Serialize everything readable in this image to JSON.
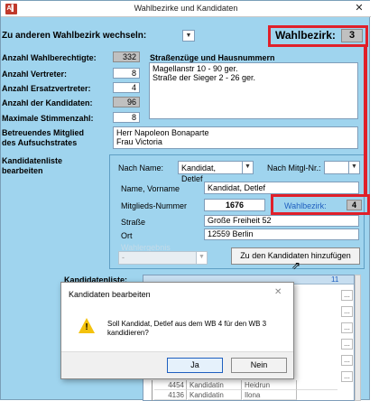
{
  "window": {
    "title": "Wahlbezirke und Kandidaten",
    "app_icon": "A▌",
    "close": "✕"
  },
  "header": {
    "switch_label": "Zu anderen Wahlbezirk wechseln:",
    "wb_label": "Wahlbezirk:",
    "wb_value": "3"
  },
  "stats": {
    "wahlberechtigte_label": "Anzahl Wahlberechtigte:",
    "wahlberechtigte": "332",
    "vertreter_label": "Anzahl Vertreter:",
    "vertreter": "8",
    "ersatz_label": "Anzahl Ersatzvertreter:",
    "ersatz": "4",
    "kandidaten_label": "Anzahl der Kandidaten:",
    "kandidaten": "96",
    "stimmen_label": "Maximale Stimmenzahl:",
    "stimmen": "8"
  },
  "streets": {
    "label": "Straßenzüge und Hausnummern",
    "line1": "Magellanstr 10 - 90  ger.",
    "line2": "Straße der Sieger 2 - 26 ger."
  },
  "mitglied": {
    "label_line1": "Betreuendes Mitglied",
    "label_line2": "des Aufsuchstrates",
    "line1": "Herr Napoleon Bonaparte",
    "line2": "Frau Victoria"
  },
  "kandidatenliste": {
    "label_line1": "Kandidatenliste",
    "label_line2": "bearbeiten"
  },
  "panel": {
    "nach_name_label": "Nach Name:",
    "nach_name_value": "Kandidat, Detlef",
    "nach_mitgl_label": "Nach Mitgl-Nr.:",
    "nach_mitgl_value": "",
    "name_label": "Name, Vorname",
    "name_value": "Kandidat, Detlef",
    "mitglieds_label": "Mitglieds-Nummer",
    "mitglieds_value": "1676",
    "wb_label": "Wahlbezirk:",
    "wb_value": "4",
    "strasse_label": "Straße",
    "strasse_value": "Große Freiheit 52",
    "ort_label": "Ort",
    "ort_value": "12559 Berlin",
    "wahlergebnis_label": "Wahlergebnis",
    "wahlergebnis_value": "-",
    "add_button": "Zu den Kandidaten hinzufügen"
  },
  "grid": {
    "label": "Kandidatenliste:",
    "header_num": "11",
    "rows": [
      {
        "nr": "4454",
        "name": "Kandidatin",
        "vorname": "Heidrun"
      },
      {
        "nr": "4136",
        "name": "Kandidatin",
        "vorname": "Ilona"
      }
    ],
    "dots": "..."
  },
  "dialog": {
    "title": "Kandidaten bearbeiten",
    "close": "✕",
    "message_line1": "Soll  Kandidat, Detlef aus dem WB 4 für den WB 3",
    "message_line2": "kandidieren?",
    "warn": "!",
    "ja": "Ja",
    "nein": "Nein"
  },
  "colors": {
    "background": "#9fd4ee",
    "highlight": "#e0202a",
    "accent_blue": "#1f5fbf"
  }
}
